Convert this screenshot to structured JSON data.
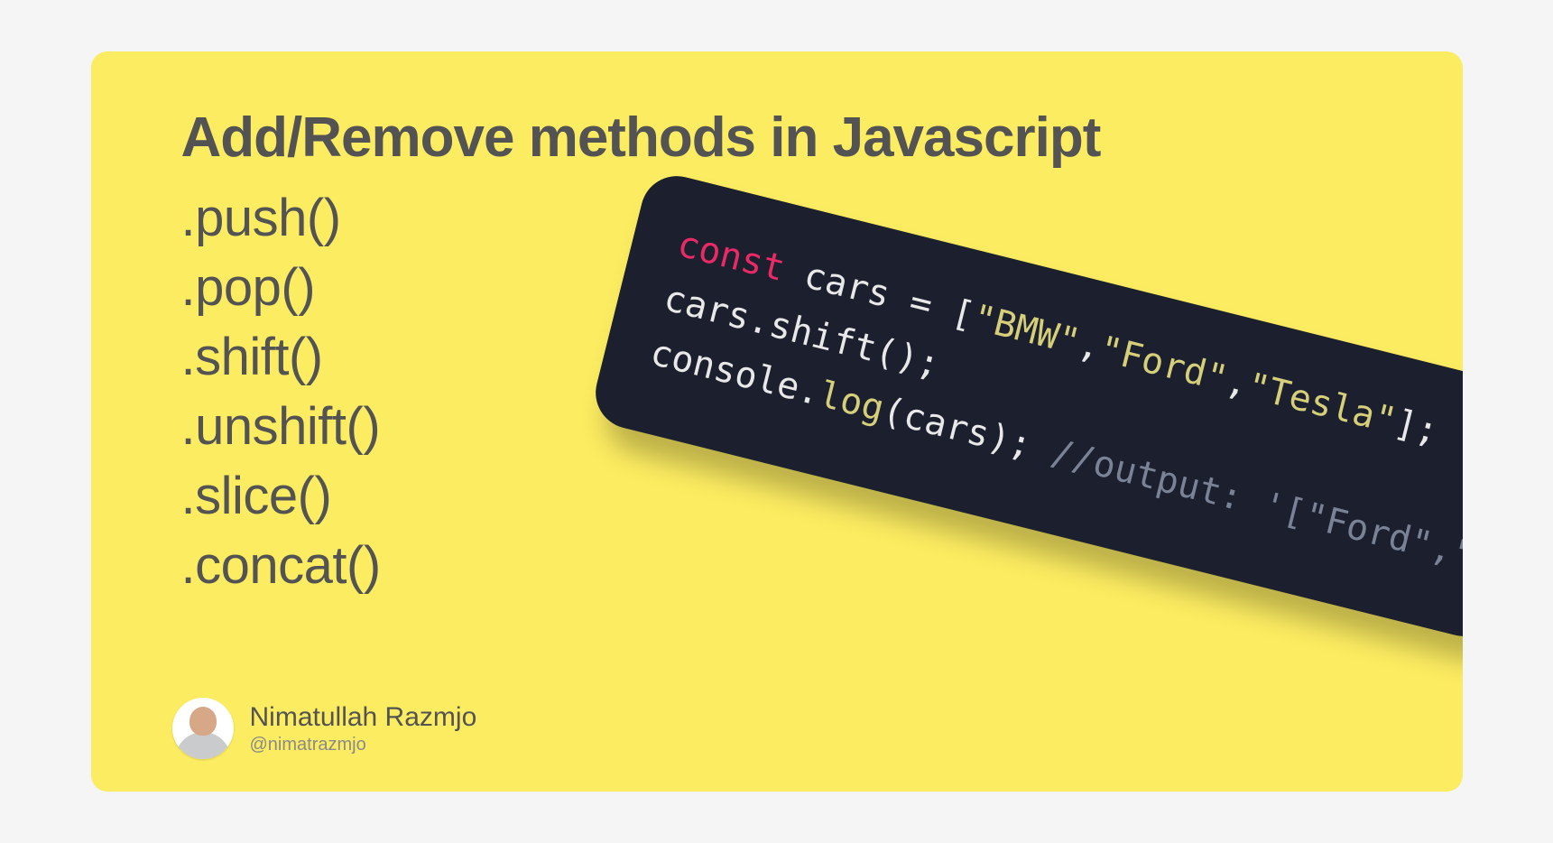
{
  "title": "Add/Remove methods in Javascript",
  "methods": [
    ".push()",
    ".pop()",
    ".shift()",
    ".unshift()",
    ".slice()",
    ".concat()"
  ],
  "code": {
    "line1": {
      "kw": "const",
      "rest": " cars = [",
      "s1": "\"BMW\"",
      "c1": ",",
      "s2": "\"Ford\"",
      "c2": ",",
      "s3": "\"Tesla\"",
      "end": "];"
    },
    "line2": "cars.shift();",
    "line3": {
      "pre": "console.",
      "fn": "log",
      "post": "(cars);  ",
      "comment": "//output: '[\"Ford\",\"Tesla\"]'"
    }
  },
  "author": {
    "name": "Nimatullah Razmjo",
    "handle": "@nimatrazmjo"
  }
}
